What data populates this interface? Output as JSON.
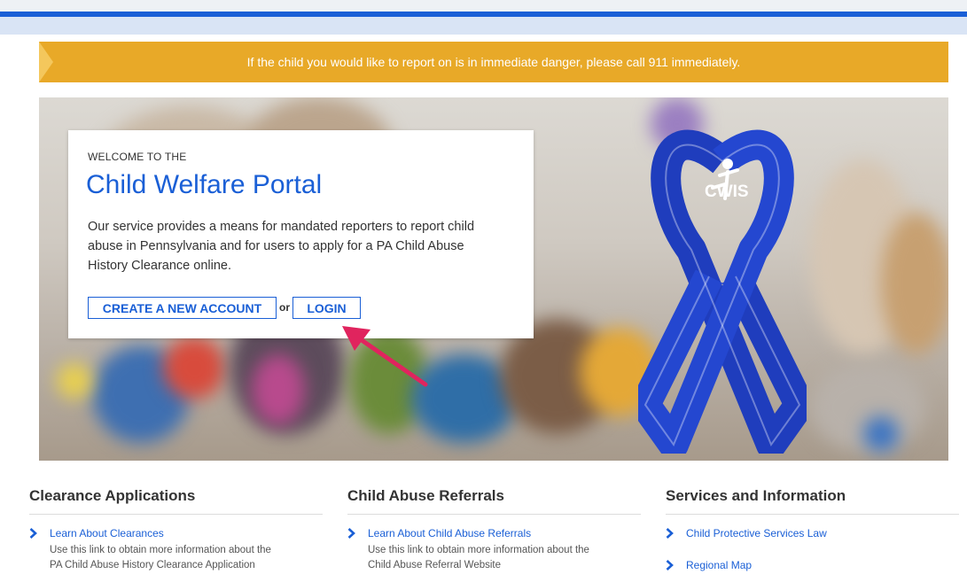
{
  "alert": {
    "message": "If the child you would like to report on is in immediate danger, please call 911 immediately."
  },
  "hero": {
    "logo_text": "CWIS",
    "ribbon_color": "#1f3dbd"
  },
  "welcome": {
    "eyebrow": "WELCOME TO THE",
    "title": "Child Welfare Portal",
    "description": "Our service provides a means for mandated reporters to report child abuse in Pennsylvania and for users to apply for a PA Child Abuse History Clearance online.",
    "create_label": "CREATE A NEW ACCOUNT",
    "or_label": "or",
    "login_label": "LOGIN"
  },
  "columns": {
    "clearance": {
      "heading": "Clearance Applications",
      "link": "Learn About Clearances",
      "desc_line1": "Use this link to obtain more information about the",
      "desc_line2": "PA Child Abuse History Clearance Application"
    },
    "referrals": {
      "heading": "Child Abuse Referrals",
      "link": "Learn About Child Abuse Referrals",
      "desc_line1": "Use this link to obtain more information about the",
      "desc_line2": "Child Abuse Referral Website"
    },
    "services": {
      "heading": "Services and Information",
      "link1": "Child Protective Services Law",
      "link2": "Regional Map"
    }
  },
  "colors": {
    "primary": "#1a5fd6",
    "alert": "#e8a928",
    "pointer_arrow": "#e0245e"
  }
}
